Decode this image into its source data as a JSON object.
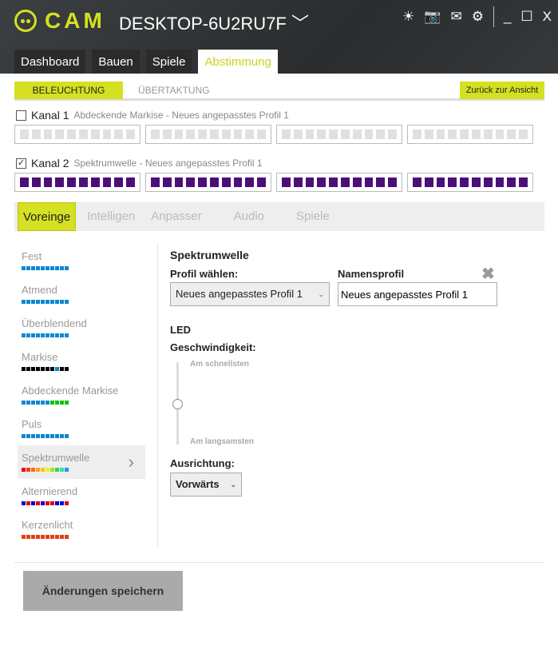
{
  "header": {
    "logo": "CAM",
    "device": "DESKTOP-6U2RU7F",
    "window": {
      "minimize": "_",
      "maximize": "☐",
      "close": "X"
    }
  },
  "tabs": [
    "Dashboard",
    "Bauen",
    "Spiele",
    "Abstimmung"
  ],
  "subtabs": [
    "BELEUCHTUNG",
    "ÜBERTAKTUNG"
  ],
  "back_button": "Zurück zur Ansicht",
  "channels": [
    {
      "label": "Kanal 1",
      "desc": "Abdeckende Markise - Neues angepasstes Profil 1",
      "checked": false,
      "check": "",
      "color": "#e0e0e0"
    },
    {
      "label": "Kanal 2",
      "desc": "Spektrumwelle - Neues angepasstes Profil 1",
      "checked": true,
      "check": "✓",
      "color": "#4b0f7a"
    }
  ],
  "mode_tabs": [
    "Voreinge",
    "Intelligen",
    "Anpasser",
    "Audio",
    "Spiele"
  ],
  "effects": [
    {
      "name": "Fest",
      "colors": [
        "#0a88d0",
        "#0a88d0",
        "#0a88d0",
        "#0a88d0",
        "#0a88d0",
        "#0a88d0",
        "#0a88d0",
        "#0a88d0",
        "#0a88d0",
        "#0a88d0"
      ]
    },
    {
      "name": "Atmend",
      "colors": [
        "#0a88d0",
        "#0a88d0",
        "#0a88d0",
        "#0a88d0",
        "#0a88d0",
        "#0a88d0",
        "#0a88d0",
        "#0a88d0",
        "#0a88d0",
        "#0a88d0"
      ]
    },
    {
      "name": "Überblendend",
      "colors": [
        "#0a88d0",
        "#0a88d0",
        "#0a88d0",
        "#0a88d0",
        "#0a88d0",
        "#0a88d0",
        "#0a88d0",
        "#0a88d0",
        "#0a88d0",
        "#0a88d0"
      ]
    },
    {
      "name": "Markise",
      "colors": [
        "#000",
        "#000",
        "#000",
        "#000",
        "#000",
        "#000",
        "#000",
        "#0a88d0",
        "#000",
        "#000"
      ]
    },
    {
      "name": "Abdeckende Markise",
      "colors": [
        "#0a88d0",
        "#0a88d0",
        "#0a88d0",
        "#0a88d0",
        "#0a88d0",
        "#0a88d0",
        "#10c010",
        "#10c010",
        "#10c010",
        "#10c010"
      ]
    },
    {
      "name": "Puls",
      "colors": [
        "#0a88d0",
        "#0a88d0",
        "#0a88d0",
        "#0a88d0",
        "#0a88d0",
        "#0a88d0",
        "#0a88d0",
        "#0a88d0",
        "#0a88d0",
        "#0a88d0"
      ]
    },
    {
      "name": "Spektrumwelle",
      "colors": [
        "#f00000",
        "#f04010",
        "#f07010",
        "#f8a030",
        "#f8c030",
        "#f0f020",
        "#a0e030",
        "#40d040",
        "#30e0c0",
        "#3090f0"
      ]
    },
    {
      "name": "Alternierend",
      "colors": [
        "#0000e0",
        "#e00000",
        "#0000e0",
        "#e00000",
        "#0000e0",
        "#e00000",
        "#e00000",
        "#0000e0",
        "#0000e0",
        "#e00000"
      ]
    },
    {
      "name": "Kerzenlicht",
      "colors": [
        "#e04010",
        "#e04010",
        "#e04010",
        "#e04010",
        "#e04010",
        "#e04010",
        "#e04010",
        "#e04010",
        "#e04010",
        "#e04010"
      ]
    }
  ],
  "selected_effect": "Spektrumwelle",
  "detail": {
    "title": "Spektrumwelle",
    "profile_label": "Profil wählen:",
    "profile_value": "Neues angepasstes Profil 1",
    "name_label": "Namensprofil",
    "name_value": "Neues angepasstes Profil 1",
    "led_label": "LED",
    "speed_label": "Geschwindigkeit:",
    "speed_fast": "Am schnellsten",
    "speed_slow": "Am langsamsten",
    "speed_value": 0.5,
    "direction_label": "Ausrichtung:",
    "direction_value": "Vorwärts"
  },
  "save_button": "Änderungen speichern"
}
